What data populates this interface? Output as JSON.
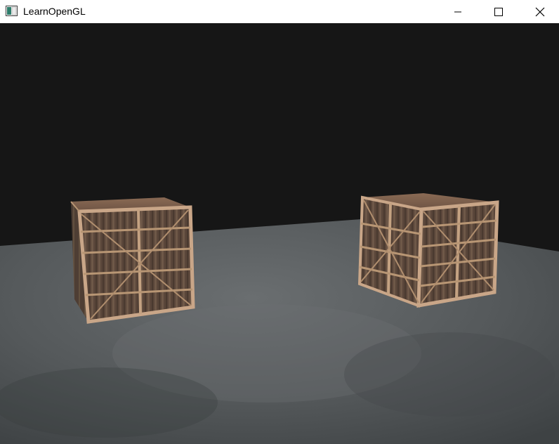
{
  "window": {
    "title": "LearnOpenGL",
    "icon": "opengl-app-icon"
  },
  "controls": {
    "minimize_icon": "minimize-icon",
    "maximize_icon": "maximize-icon",
    "close_icon": "close-icon"
  },
  "scene": {
    "background_color": "#161616",
    "floor_color": "#55585a",
    "crate_color": "#6a5446",
    "crate_edge_color": "#c9a688",
    "objects": [
      "floor-plane",
      "wooden-crate-left",
      "wooden-crate-right"
    ]
  }
}
